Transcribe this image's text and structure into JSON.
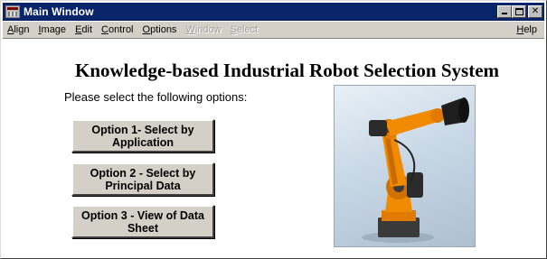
{
  "window": {
    "title": "Main Window"
  },
  "menu": {
    "items": [
      {
        "label": "Align",
        "accel": "A",
        "rest": "lign",
        "enabled": true
      },
      {
        "label": "Image",
        "accel": "I",
        "rest": "mage",
        "enabled": true
      },
      {
        "label": "Edit",
        "accel": "E",
        "rest": "dit",
        "enabled": true
      },
      {
        "label": "Control",
        "accel": "C",
        "rest": "ontrol",
        "enabled": true
      },
      {
        "label": "Options",
        "accel": "O",
        "rest": "ptions",
        "enabled": true
      },
      {
        "label": "Window",
        "accel": "W",
        "rest": "indow",
        "enabled": false
      },
      {
        "label": "Select",
        "accel": "S",
        "rest": "elect",
        "enabled": false
      }
    ],
    "help": {
      "label": "Help",
      "accel": "H",
      "rest": "elp"
    }
  },
  "main": {
    "title": "Knowledge-based Industrial Robot Selection System",
    "prompt": "Please select the following options:",
    "options": [
      {
        "label": "Option 1- Select by Application"
      },
      {
        "label": "Option 2 - Select by Principal Data"
      },
      {
        "label": "Option 3 - View of Data Sheet"
      }
    ]
  },
  "colors": {
    "titlebar": "#0a246a",
    "menubar": "#d4d0c8",
    "robot_orange": "#f08a00"
  },
  "image": {
    "subject": "orange-industrial-robot-arm"
  }
}
